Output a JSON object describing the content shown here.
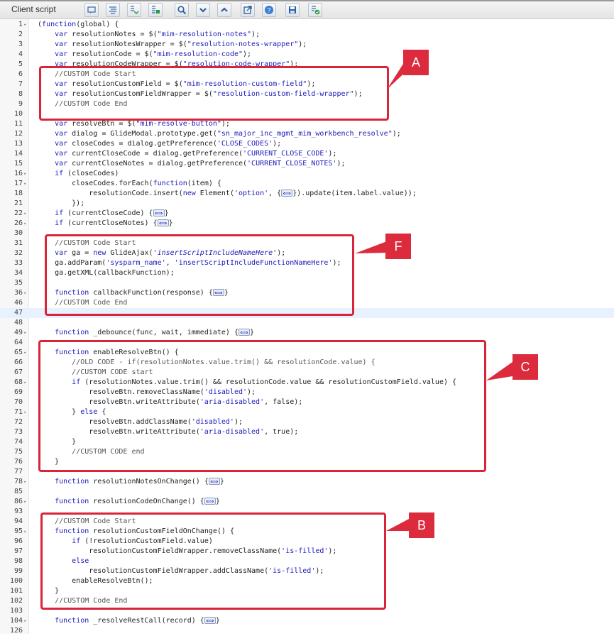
{
  "toolbar": {
    "title": "Client script",
    "buttons": [
      {
        "name": "comment-icon"
      },
      {
        "name": "format-icon"
      },
      {
        "name": "script-include-icon"
      },
      {
        "name": "replace-icon"
      },
      {
        "name": "search-icon"
      },
      {
        "name": "chevron-down-icon"
      },
      {
        "name": "chevron-up-icon"
      },
      {
        "name": "external-link-icon"
      },
      {
        "name": "help-icon"
      },
      {
        "name": "save-icon"
      },
      {
        "name": "validate-icon"
      }
    ]
  },
  "code": {
    "lines": [
      {
        "n": "1",
        "fold": true,
        "text": "(function(global) {"
      },
      {
        "n": "2",
        "text": "    var resolutionNotes = $(\"mim-resolution-notes\");"
      },
      {
        "n": "3",
        "text": "    var resolutionNotesWrapper = $(\"resolution-notes-wrapper\");"
      },
      {
        "n": "4",
        "text": "    var resolutionCode = $(\"mim-resolution-code\");"
      },
      {
        "n": "5",
        "text": "    var resolutionCodeWrapper = $(\"resolution-code-wrapper\");"
      },
      {
        "n": "6",
        "text": "    //CUSTOM Code Start"
      },
      {
        "n": "7",
        "text": "    var resolutionCustomField = $(\"mim-resolution-custom-field\");"
      },
      {
        "n": "8",
        "text": "    var resolutionCustomFieldWrapper = $(\"resolution-custom-field-wrapper\");"
      },
      {
        "n": "9",
        "text": "    //CUSTOM Code End"
      },
      {
        "n": "10",
        "text": ""
      },
      {
        "n": "11",
        "text": "    var resolveBtn = $(\"mim-resolve-button\");"
      },
      {
        "n": "12",
        "text": "    var dialog = GlideModal.prototype.get(\"sn_major_inc_mgmt_mim_workbench_resolve\");"
      },
      {
        "n": "13",
        "text": "    var closeCodes = dialog.getPreference('CLOSE_CODES');"
      },
      {
        "n": "14",
        "text": "    var currentCloseCode = dialog.getPreference('CURRENT_CLOSE_CODE');"
      },
      {
        "n": "15",
        "text": "    var currentCloseNotes = dialog.getPreference('CURRENT_CLOSE_NOTES');"
      },
      {
        "n": "16",
        "fold": true,
        "text": "    if (closeCodes)"
      },
      {
        "n": "17",
        "fold": true,
        "text": "        closeCodes.forEach(function(item) {"
      },
      {
        "n": "18",
        "text": "            resolutionCode.insert(new Element('option', {⟺}).update(item.label.value));"
      },
      {
        "n": "21",
        "text": "        });"
      },
      {
        "n": "22",
        "fold": true,
        "text": "    if (currentCloseCode) {⟺}"
      },
      {
        "n": "26",
        "fold": true,
        "text": "    if (currentCloseNotes) {⟺}"
      },
      {
        "n": "30",
        "text": ""
      },
      {
        "n": "31",
        "text": "    //CUSTOM Code Start"
      },
      {
        "n": "32",
        "text": "    var ga = new GlideAjax('insertScriptIncludeNameHere');"
      },
      {
        "n": "33",
        "text": "    ga.addParam('sysparm_name', 'insertScriptIncludeFunctionNameHere');"
      },
      {
        "n": "34",
        "text": "    ga.getXML(callbackFunction);"
      },
      {
        "n": "35",
        "text": ""
      },
      {
        "n": "36",
        "fold": true,
        "text": "    function callbackFunction(response) {⟺}"
      },
      {
        "n": "46",
        "text": "    //CUSTOM Code End"
      },
      {
        "n": "47",
        "text": "",
        "active": true
      },
      {
        "n": "48",
        "text": ""
      },
      {
        "n": "49",
        "fold": true,
        "text": "    function _debounce(func, wait, immediate) {⟺}"
      },
      {
        "n": "64",
        "text": ""
      },
      {
        "n": "65",
        "fold": true,
        "text": "    function enableResolveBtn() {"
      },
      {
        "n": "66",
        "text": "        //OLD CODE - if(resolutionNotes.value.trim() && resolutionCode.value) {"
      },
      {
        "n": "67",
        "text": "        //CUSTOM CODE start"
      },
      {
        "n": "68",
        "fold": true,
        "text": "        if (resolutionNotes.value.trim() && resolutionCode.value && resolutionCustomField.value) {"
      },
      {
        "n": "69",
        "text": "            resolveBtn.removeClassName('disabled');"
      },
      {
        "n": "70",
        "text": "            resolveBtn.writeAttribute('aria-disabled', false);"
      },
      {
        "n": "71",
        "fold": true,
        "text": "        } else {"
      },
      {
        "n": "72",
        "text": "            resolveBtn.addClassName('disabled');"
      },
      {
        "n": "73",
        "text": "            resolveBtn.writeAttribute('aria-disabled', true);"
      },
      {
        "n": "74",
        "text": "        }"
      },
      {
        "n": "75",
        "text": "        //CUSTOM CODE end"
      },
      {
        "n": "76",
        "text": "    }"
      },
      {
        "n": "77",
        "text": ""
      },
      {
        "n": "78",
        "fold": true,
        "text": "    function resolutionNotesOnChange() {⟺}"
      },
      {
        "n": "85",
        "text": ""
      },
      {
        "n": "86",
        "fold": true,
        "text": "    function resolutionCodeOnChange() {⟺}"
      },
      {
        "n": "93",
        "text": ""
      },
      {
        "n": "94",
        "text": "    //CUSTOM Code Start"
      },
      {
        "n": "95",
        "fold": true,
        "text": "    function resolutionCustomFieldOnChange() {"
      },
      {
        "n": "96",
        "text": "        if (!resolutionCustomField.value)"
      },
      {
        "n": "97",
        "text": "            resolutionCustomFieldWrapper.removeClassName('is-filled');"
      },
      {
        "n": "98",
        "text": "        else"
      },
      {
        "n": "99",
        "text": "            resolutionCustomFieldWrapper.addClassName('is-filled');"
      },
      {
        "n": "100",
        "text": "        enableResolveBtn();"
      },
      {
        "n": "101",
        "text": "    }"
      },
      {
        "n": "102",
        "text": "    //CUSTOM Code End"
      },
      {
        "n": "103",
        "text": ""
      },
      {
        "n": "104",
        "fold": true,
        "text": "    function _resolveRestCall(record) {⟺}"
      },
      {
        "n": "126",
        "text": ""
      }
    ]
  },
  "annotations": {
    "A": "A",
    "F": "F",
    "C": "C",
    "B": "B"
  }
}
